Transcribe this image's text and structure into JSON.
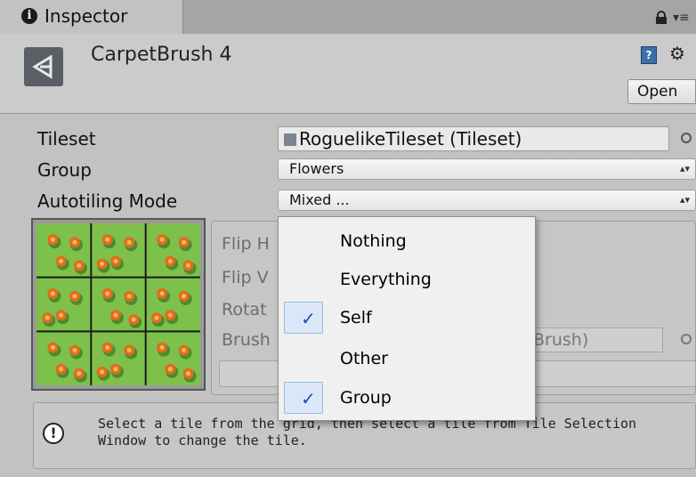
{
  "tab": {
    "title": "Inspector",
    "info_icon": "i"
  },
  "header": {
    "asset_name": "CarpetBrush 4",
    "help_glyph": "?",
    "open_label": "Open"
  },
  "fields": {
    "tileset_label": "Tileset",
    "tileset_value": "RoguelikeTileset (Tileset)",
    "group_label": "Group",
    "group_value": "Flowers",
    "mode_label": "Autotiling Mode",
    "mode_value": "Mixed ..."
  },
  "panel": {
    "flip_h": "Flip H",
    "flip_v": "Flip V",
    "rotate": "Rotat",
    "brush": "Brush",
    "brush_value": "Brush)"
  },
  "help": {
    "text": "Select  a tile from the grid, then select a tile from Tile Selection Window to change the tile."
  },
  "dropdown": {
    "items": [
      {
        "label": "Nothing",
        "checked": false
      },
      {
        "label": "Everything",
        "checked": false
      },
      {
        "label": "Self",
        "checked": true
      },
      {
        "label": "Other",
        "checked": false
      },
      {
        "label": "Group",
        "checked": true
      }
    ]
  },
  "colors": {
    "checkmark": "#1a4fb0",
    "grass": "#7dc14a",
    "flower": "#e06b2a"
  }
}
